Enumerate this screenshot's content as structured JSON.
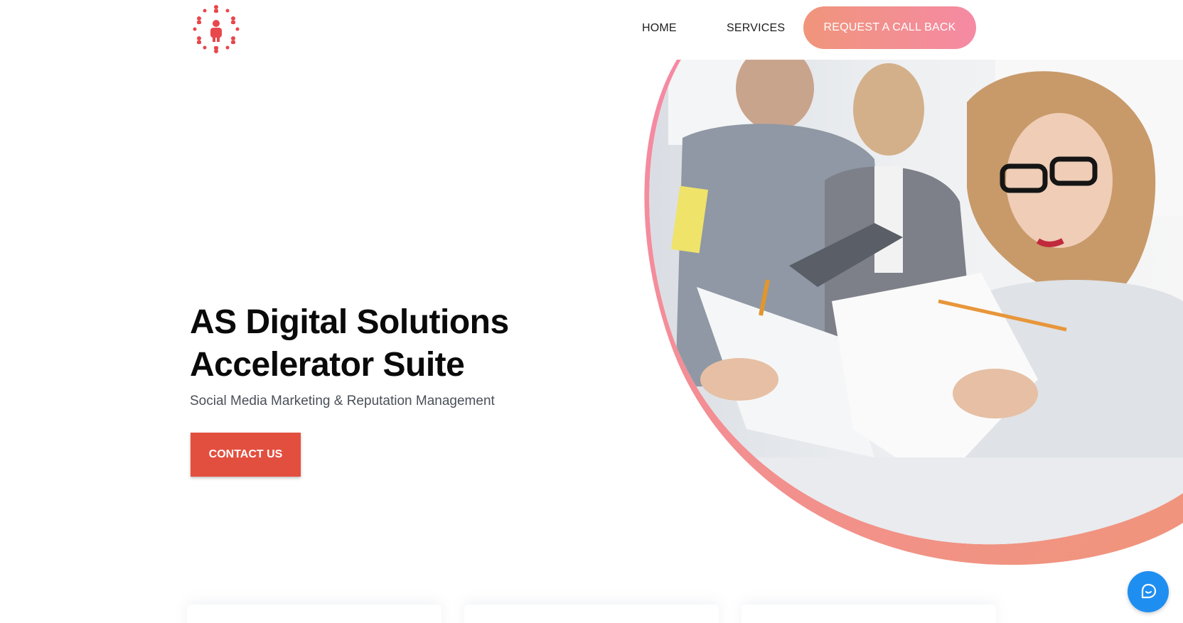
{
  "header": {
    "logo_icon": "team-network-icon",
    "nav": {
      "home_label": "HOME",
      "services_label": "SERVICES",
      "callback_label": "REQUEST A CALL BACK"
    }
  },
  "hero": {
    "title_line1": "AS Digital Solutions",
    "title_line2": "Accelerator Suite",
    "subtitle": "Social Media Marketing & Reputation Management",
    "cta_label": "CONTACT US",
    "image_icon": "office-team-photo"
  },
  "chat": {
    "icon": "chat-icon"
  },
  "colors": {
    "accent_red": "#e34f3f",
    "gradient_start": "#f0957b",
    "gradient_end": "#f58aa4",
    "chat_blue": "#1f8ef1"
  }
}
